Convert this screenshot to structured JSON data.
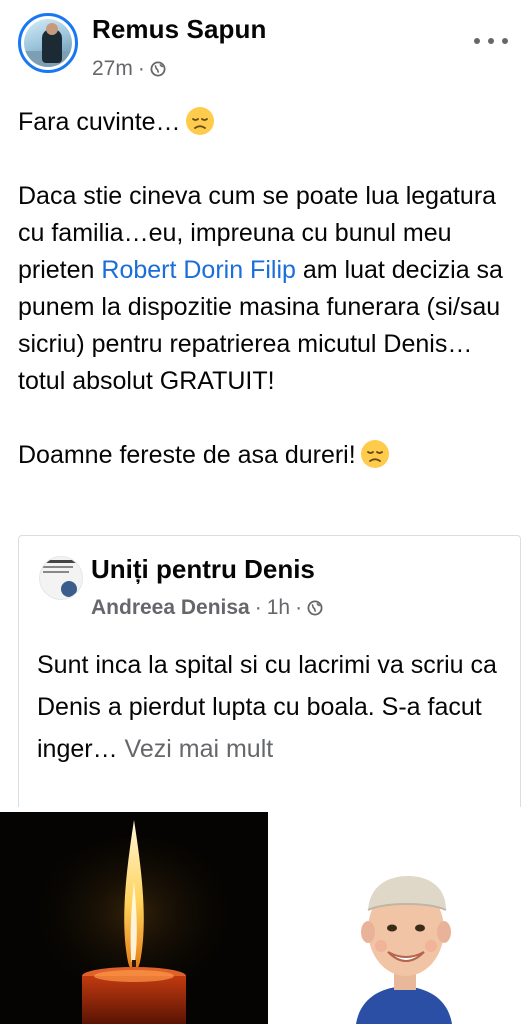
{
  "post": {
    "author": "Remus Sapun",
    "time": "27m",
    "separator": "·",
    "privacy_icon": "globe-icon",
    "menu_icon": "more-horizontal-icon"
  },
  "body": {
    "line1": "Fara cuvinte…",
    "para2_before_link": "Daca stie cineva cum se poate lua legatura cu familia…eu, impreuna cu bunul meu prieten ",
    "mention": "Robert Dorin Filip",
    "para2_after_link": " am luat decizia sa punem la dispozitie masina funerara (si/sau sicriu) pentru repatrierea micutul Denis… totul absolut GRATUIT!",
    "line_last": "Doamne fereste de asa dureri!",
    "emoji": "disappointed-face-emoji"
  },
  "shared": {
    "group": "Uniți pentru Denis",
    "page": "Andreea Denisa",
    "time": "1h",
    "separator": "·",
    "text": "Sunt inca la spital si cu lacrimi va scriu ca Denis a pierdut lupta cu boala. S-a facut inger…",
    "see_more": "Vezi mai mult"
  },
  "colors": {
    "link": "#1a6ed8",
    "muted": "#65676b",
    "avatar_ring": "#1877f2"
  }
}
